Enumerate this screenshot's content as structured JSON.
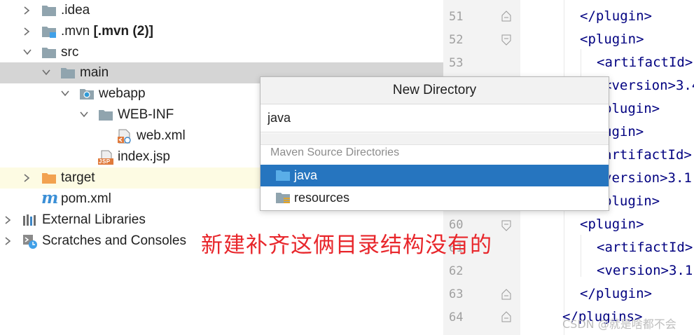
{
  "colors": {
    "folder": "#90a4ae",
    "folder_excluded": "#f2a250",
    "selection": "#2675bf",
    "annotation": "#e8262b",
    "xml_tag": "#000080"
  },
  "tree": {
    "items": [
      {
        "label": ".idea",
        "icon": "folder-icon"
      },
      {
        "label": ".mvn",
        "suffix": "[.mvn (2)]",
        "icon": "module-folder-icon"
      },
      {
        "label": "src",
        "icon": "folder-icon"
      },
      {
        "label": "main",
        "icon": "folder-icon"
      },
      {
        "label": "webapp",
        "icon": "web-folder-icon"
      },
      {
        "label": "WEB-INF",
        "icon": "folder-icon"
      },
      {
        "label": "web.xml",
        "icon": "web-xml-file-icon"
      },
      {
        "label": "index.jsp",
        "icon": "jsp-file-icon"
      },
      {
        "label": "target",
        "icon": "excluded-folder-icon"
      },
      {
        "label": "pom.xml",
        "icon": "maven-icon"
      },
      {
        "label": "External Libraries",
        "icon": "libraries-icon"
      },
      {
        "label": "Scratches and Consoles",
        "icon": "scratches-icon"
      }
    ],
    "jsp_badge": "JSP",
    "maven_glyph": "m"
  },
  "editor": {
    "line_numbers": [
      "51",
      "52",
      "53",
      "60",
      "61",
      "62",
      "63",
      "64"
    ],
    "lines": [
      "</plugin>",
      "<plugin>",
      "<artifactId>",
      "<version>3.4",
      "plugin>",
      "ugin>",
      "artifactId>",
      "version>3.1",
      "plugin>",
      "<plugin>",
      "<artifactId>",
      "<version>3.1",
      "</plugin>",
      "</plugins>"
    ]
  },
  "popup": {
    "title": "New Directory",
    "input_value": "java",
    "section_label": "Maven Source Directories",
    "options": [
      {
        "label": "java",
        "icon": "source-folder-icon",
        "selected": true
      },
      {
        "label": "resources",
        "icon": "resources-folder-icon",
        "selected": false
      }
    ]
  },
  "annotation": "新建补齐这俩目录结构没有的",
  "watermark": "CSDN @就是啥都不会"
}
